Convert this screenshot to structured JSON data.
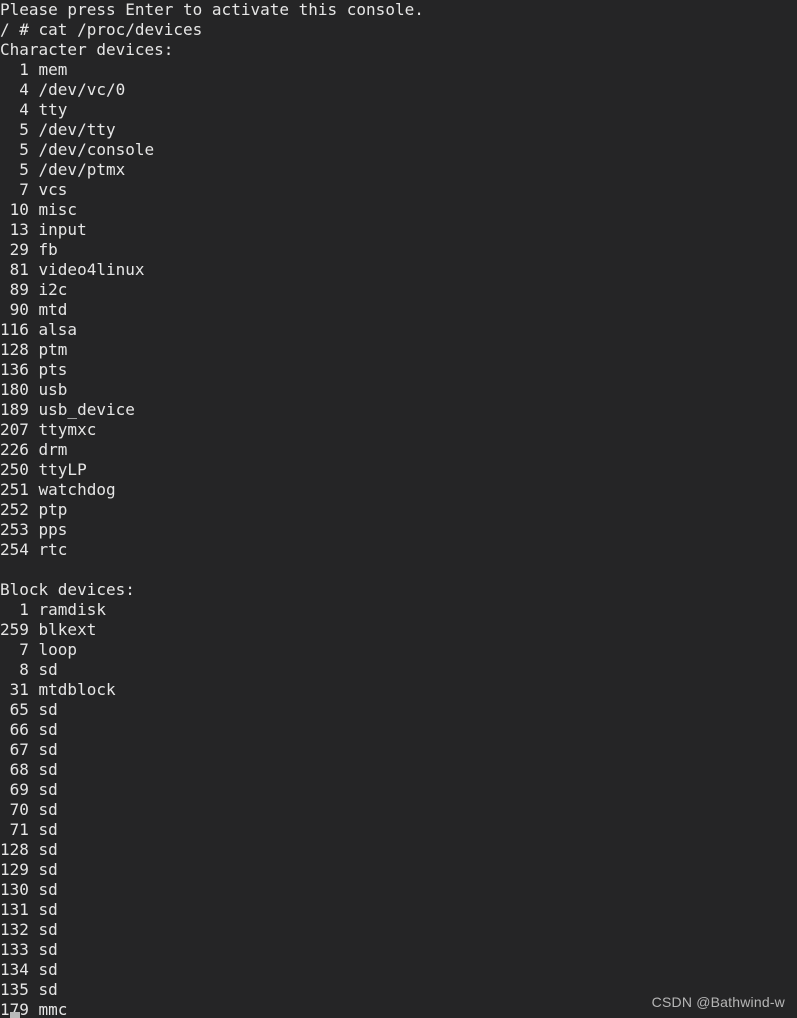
{
  "terminal": {
    "background_color": "#252526",
    "text_color": "#e6e6e6",
    "lines": [
      "Please press Enter to activate this console.",
      "/ # cat /proc/devices",
      "Character devices:",
      "  1 mem",
      "  4 /dev/vc/0",
      "  4 tty",
      "  5 /dev/tty",
      "  5 /dev/console",
      "  5 /dev/ptmx",
      "  7 vcs",
      " 10 misc",
      " 13 input",
      " 29 fb",
      " 81 video4linux",
      " 89 i2c",
      " 90 mtd",
      "116 alsa",
      "128 ptm",
      "136 pts",
      "180 usb",
      "189 usb_device",
      "207 ttymxc",
      "226 drm",
      "250 ttyLP",
      "251 watchdog",
      "252 ptp",
      "253 pps",
      "254 rtc",
      "",
      "Block devices:",
      "  1 ramdisk",
      "259 blkext",
      "  7 loop",
      "  8 sd",
      " 31 mtdblock",
      " 65 sd",
      " 66 sd",
      " 67 sd",
      " 68 sd",
      " 69 sd",
      " 70 sd",
      " 71 sd",
      "128 sd",
      "129 sd",
      "130 sd",
      "131 sd",
      "132 sd",
      "133 sd",
      "134 sd",
      "135 sd",
      "179 mmc"
    ],
    "prompt": "/ # ",
    "command": "cat /proc/devices",
    "cursor_color": "#b9b9b9"
  },
  "watermark": {
    "text": "CSDN @Bathwind-w",
    "color": "#b6b6b6"
  }
}
